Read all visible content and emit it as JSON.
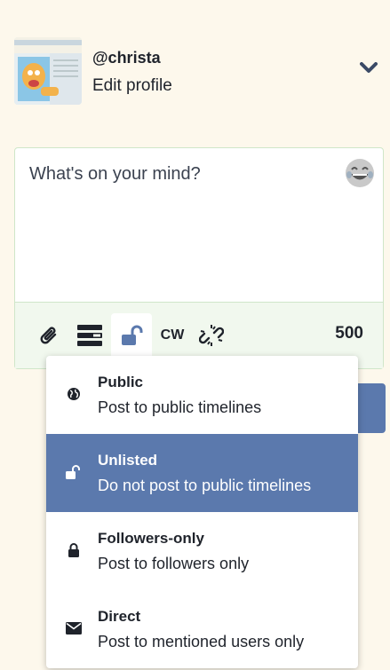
{
  "profile": {
    "handle": "@christa",
    "edit_label": "Edit profile"
  },
  "composer": {
    "placeholder": "What's on your mind?",
    "toolbar": {
      "cw_label": "CW",
      "char_count": "500"
    }
  },
  "privacy_menu": {
    "options": [
      {
        "title": "Public",
        "description": "Post to public timelines",
        "icon": "globe-icon",
        "selected": false
      },
      {
        "title": "Unlisted",
        "description": "Do not post to public timelines",
        "icon": "unlock-icon",
        "selected": true
      },
      {
        "title": "Followers-only",
        "description": "Post to followers only",
        "icon": "lock-icon",
        "selected": false
      },
      {
        "title": "Direct",
        "description": "Post to mentioned users only",
        "icon": "envelope-icon",
        "selected": false
      }
    ]
  },
  "colors": {
    "accent": "#5b79ad",
    "background": "#fdf8ec",
    "toolbar_bg": "#f1f8ee"
  }
}
